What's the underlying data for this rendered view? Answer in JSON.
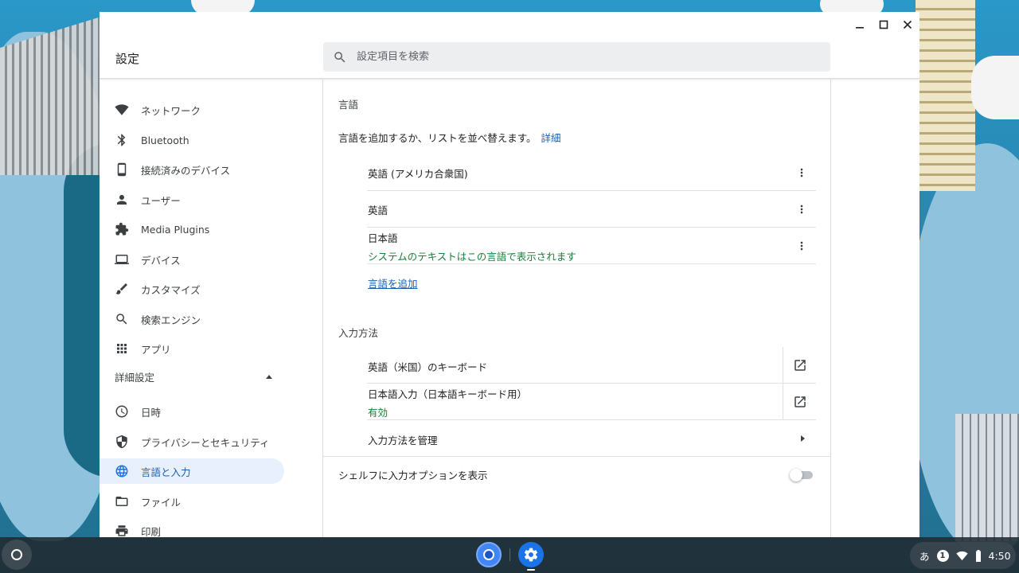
{
  "window": {
    "app_title": "設定",
    "search_placeholder": "設定項目を検索"
  },
  "sidebar": {
    "items": [
      {
        "label": "ネットワーク",
        "icon": "wifi-icon"
      },
      {
        "label": "Bluetooth",
        "icon": "bluetooth-icon"
      },
      {
        "label": "接続済みのデバイス",
        "icon": "phone-icon"
      },
      {
        "label": "ユーザー",
        "icon": "person-icon"
      },
      {
        "label": "Media Plugins",
        "icon": "puzzle-icon"
      },
      {
        "label": "デバイス",
        "icon": "laptop-icon"
      },
      {
        "label": "カスタマイズ",
        "icon": "brush-icon"
      },
      {
        "label": "検索エンジン",
        "icon": "search-icon"
      },
      {
        "label": "アプリ",
        "icon": "apps-grid-icon"
      }
    ],
    "advanced_label": "詳細設定",
    "advanced_items": [
      {
        "label": "日時",
        "icon": "clock-icon"
      },
      {
        "label": "プライバシーとセキュリティ",
        "icon": "shield-icon"
      },
      {
        "label": "言語と入力",
        "icon": "globe-icon",
        "active": true
      },
      {
        "label": "ファイル",
        "icon": "folder-icon"
      },
      {
        "label": "印刷",
        "icon": "printer-icon"
      }
    ]
  },
  "languages": {
    "title": "言語",
    "description": "言語を追加するか、リストを並べ替えます。",
    "learn_more": "詳細",
    "items": [
      {
        "name": "英語 (アメリカ合衆国)",
        "note": ""
      },
      {
        "name": "英語",
        "note": ""
      },
      {
        "name": "日本語",
        "note": "システムのテキストはこの言語で表示されます"
      }
    ],
    "add_language": "言語を追加"
  },
  "input_methods": {
    "title": "入力方法",
    "items": [
      {
        "name": "英語（米国）のキーボード",
        "status": ""
      },
      {
        "name": "日本語入力（日本語キーボード用）",
        "status": "有効"
      }
    ],
    "manage": "入力方法を管理"
  },
  "shelf_option": {
    "label": "シェルフに入力オプションを表示",
    "enabled": false
  },
  "tray": {
    "ime": "あ",
    "notification_count": "1",
    "time": "4:50"
  },
  "colors": {
    "accent": "#1a73e8",
    "link": "#1a5fb4",
    "status_green": "#188038",
    "active_bg": "#e8f0fe"
  }
}
